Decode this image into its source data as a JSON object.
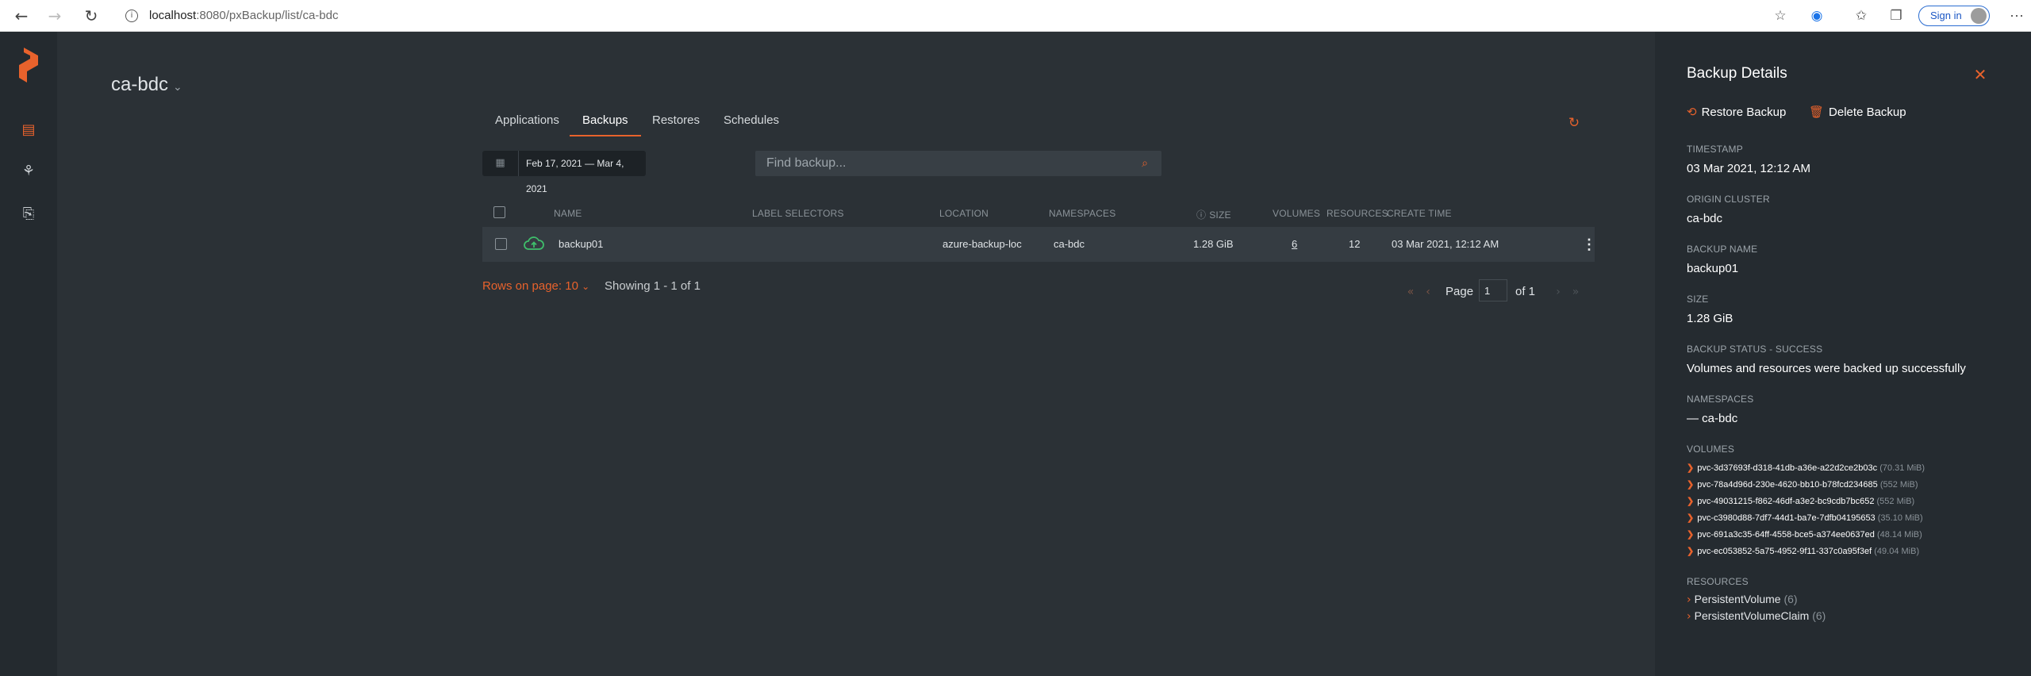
{
  "browser": {
    "url_host": "localhost",
    "url_path": ":8080/pxBackup/list/ca-bdc",
    "signin_label": "Sign in"
  },
  "sidebar": {
    "icons": [
      "backup-icon",
      "cluster-icon",
      "settings-icon"
    ]
  },
  "cluster": {
    "name": "ca-bdc"
  },
  "tabs": [
    "Applications",
    "Backups",
    "Restores",
    "Schedules"
  ],
  "active_tab": "Backups",
  "filters": {
    "date_start": "Feb 17, 2021",
    "date_sep": "—",
    "date_end": "Mar 4, 2021",
    "search_placeholder": "Find backup..."
  },
  "table": {
    "headers": {
      "name": "NAME",
      "labels": "LABEL SELECTORS",
      "location": "LOCATION",
      "namespaces": "NAMESPACES",
      "size": "SIZE",
      "volumes": "VOLUMES",
      "resources": "RESOURCES",
      "create_time": "CREATE TIME"
    },
    "rows": [
      {
        "name": "backup01",
        "labels": "",
        "location": "azure-backup-loc",
        "namespaces": "ca-bdc",
        "size": "1.28 GiB",
        "volumes": "6",
        "resources": "12",
        "create_time": "03 Mar 2021, 12:12 AM",
        "status": "success"
      }
    ]
  },
  "pagination": {
    "rows_label": "Rows on page: 10",
    "showing": "Showing 1 - 1 of 1",
    "page_label": "Page",
    "page_value": "1",
    "of_label": "of 1"
  },
  "details": {
    "title": "Backup Details",
    "restore_label": "Restore Backup",
    "delete_label": "Delete Backup",
    "timestamp_label": "TIMESTAMP",
    "timestamp": "03 Mar 2021, 12:12 AM",
    "origin_label": "ORIGIN CLUSTER",
    "origin": "ca-bdc",
    "name_label": "BACKUP NAME",
    "name": "backup01",
    "size_label": "SIZE",
    "size": "1.28 GiB",
    "status_label": "BACKUP STATUS - SUCCESS",
    "status_text": "Volumes and resources were backed up successfully",
    "namespaces_label": "NAMESPACES",
    "namespace": "— ca-bdc",
    "volumes_label": "VOLUMES",
    "volumes": [
      {
        "id": "pvc-3d37693f-d318-41db-a36e-a22d2ce2b03c",
        "size": "(70.31 MiB)"
      },
      {
        "id": "pvc-78a4d96d-230e-4620-bb10-b78fcd234685",
        "size": "(552 MiB)"
      },
      {
        "id": "pvc-49031215-f862-46df-a3e2-bc9cdb7bc652",
        "size": "(552 MiB)"
      },
      {
        "id": "pvc-c3980d88-7df7-44d1-ba7e-7dfb04195653",
        "size": "(35.10 MiB)"
      },
      {
        "id": "pvc-691a3c35-64ff-4558-bce5-a374ee0637ed",
        "size": "(48.14 MiB)"
      },
      {
        "id": "pvc-ec053852-5a75-4952-9f11-337c0a95f3ef",
        "size": "(49.04 MiB)"
      }
    ],
    "resources_label": "RESOURCES",
    "resources": [
      {
        "name": "PersistentVolume",
        "count": "(6)"
      },
      {
        "name": "PersistentVolumeClaim",
        "count": "(6)"
      }
    ]
  }
}
